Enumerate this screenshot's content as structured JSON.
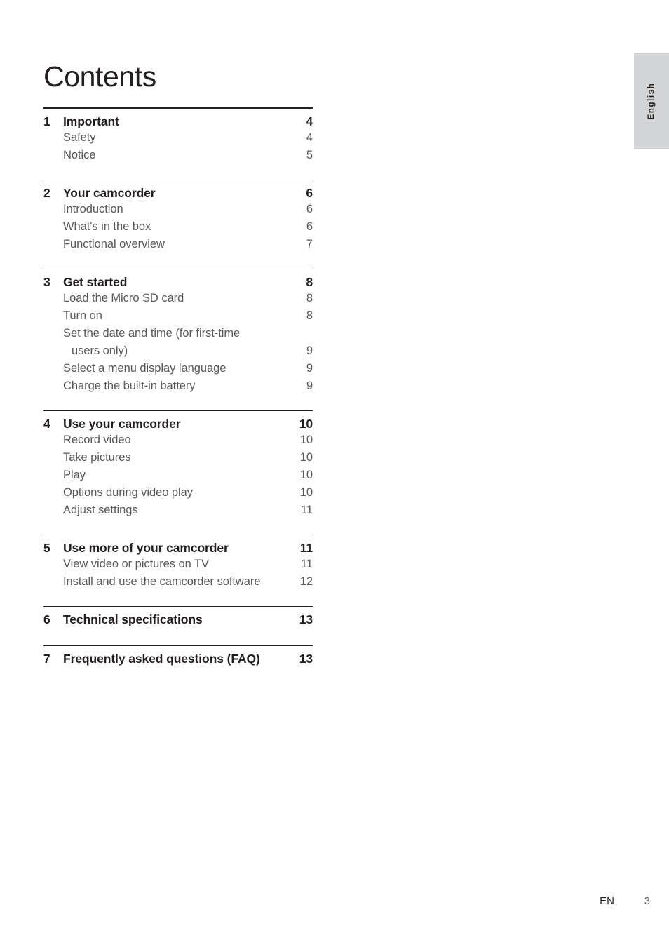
{
  "page": {
    "title": "Contents",
    "language_tab": "English",
    "footer": {
      "language_code": "EN",
      "page_number": "3"
    },
    "colors": {
      "heading": "#231f20",
      "subentry": "#58585a",
      "tab_background": "#d3d4d6",
      "rule": "#231f20"
    }
  },
  "toc": {
    "sections": [
      {
        "number": "1",
        "title": "Important",
        "page": "4",
        "entries": [
          {
            "label": "Safety",
            "page": "4"
          },
          {
            "label": "Notice",
            "page": "5"
          }
        ]
      },
      {
        "number": "2",
        "title": "Your camcorder",
        "page": "6",
        "entries": [
          {
            "label": "Introduction",
            "page": "6"
          },
          {
            "label": "What's in the box",
            "page": "6"
          },
          {
            "label": "Functional overview",
            "page": "7"
          }
        ]
      },
      {
        "number": "3",
        "title": "Get started",
        "page": "8",
        "entries": [
          {
            "label": "Load the Micro SD card",
            "page": "8"
          },
          {
            "label": "Turn on",
            "page": "8"
          },
          {
            "label": "Set the date and time (for first-time",
            "label_continued": "users only)",
            "page": "9"
          },
          {
            "label": "Select a menu display language",
            "page": "9"
          },
          {
            "label": "Charge the built-in battery",
            "page": "9"
          }
        ]
      },
      {
        "number": "4",
        "title": "Use your camcorder",
        "page": "10",
        "entries": [
          {
            "label": "Record video",
            "page": "10"
          },
          {
            "label": "Take pictures",
            "page": "10"
          },
          {
            "label": "Play",
            "page": "10"
          },
          {
            "label": "Options during video play",
            "page": "10"
          },
          {
            "label": "Adjust settings",
            "page": "11"
          }
        ]
      },
      {
        "number": "5",
        "title": "Use more of your camcorder",
        "page": "11",
        "entries": [
          {
            "label": "View video or pictures on TV",
            "page": "11"
          },
          {
            "label": "Install and use the camcorder software",
            "page": "12"
          }
        ]
      },
      {
        "number": "6",
        "title": "Technical specifications",
        "page": "13",
        "entries": []
      },
      {
        "number": "7",
        "title": "Frequently asked questions (FAQ)",
        "page": "13",
        "entries": []
      }
    ]
  }
}
